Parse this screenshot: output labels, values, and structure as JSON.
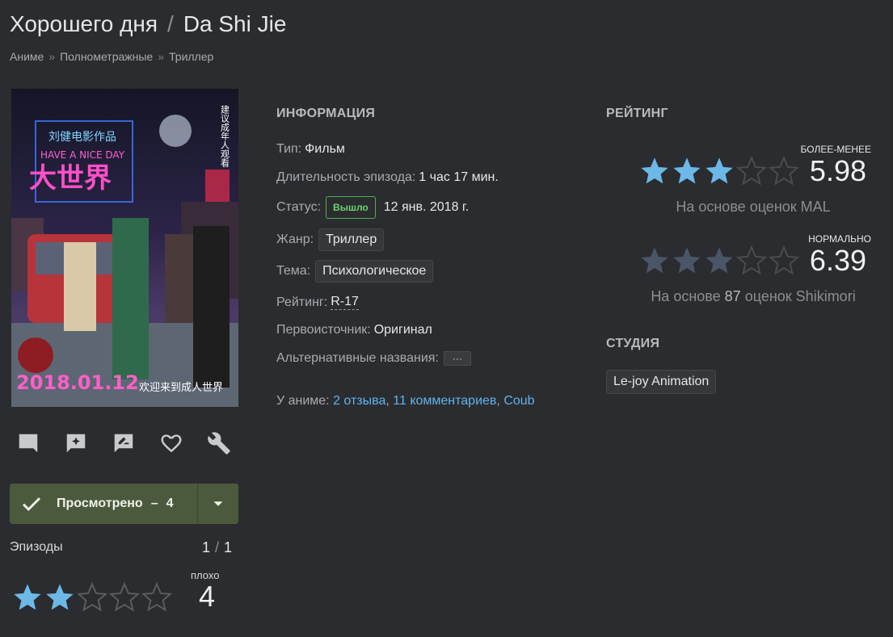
{
  "header": {
    "title_main": "Хорошего дня",
    "title_sep": "/",
    "title_orig": "Da Shi Jie",
    "breadcrumbs": [
      "Аниме",
      "Полнометражные",
      "Триллер"
    ],
    "crumb_sep": "»"
  },
  "poster": {
    "date_text": "2018.01.12",
    "title_text": "大世界",
    "side_text": "建议成年人观看",
    "tagline": "欢迎来到成人世界",
    "neon_subtitle": "刘健电影作品",
    "english_title": "HAVE A NICE DAY"
  },
  "actions": [
    {
      "icon": "comment-icon"
    },
    {
      "icon": "add-review-icon"
    },
    {
      "icon": "edit-review-icon"
    },
    {
      "icon": "heart-icon"
    },
    {
      "icon": "wrench-icon"
    }
  ],
  "watched_button": {
    "label": "Просмотрено",
    "dash": "–",
    "count": "4",
    "color": "#4b5a3c"
  },
  "episodes": {
    "label": "Эпизоды",
    "watched": "1",
    "slash": "/",
    "total": "1"
  },
  "user_rating": {
    "word": "плохо",
    "value": "4",
    "stars_filled": 2,
    "stars_total": 5
  },
  "info": {
    "heading": "ИНФОРМАЦИЯ",
    "type_label": "Тип:",
    "type_value": "Фильм",
    "duration_label": "Длительность эпизода:",
    "duration_value": "1 час 17 мин.",
    "status_label": "Статус:",
    "status_badge": "Вышло",
    "status_date": "12 янв. 2018 г.",
    "genre_label": "Жанр:",
    "genre_value": "Триллер",
    "theme_label": "Тема:",
    "theme_value": "Психологическое",
    "rating_label": "Рейтинг:",
    "rating_value": "R-17",
    "source_label": "Первоисточник:",
    "source_value": "Оригинал",
    "alt_label": "Альтернативные названия:",
    "alt_button": "···"
  },
  "reviews": {
    "prefix": "У аниме:",
    "reviews_link": "2 отзыва",
    "comments_link": "11 комментариев",
    "coub_link": "Coub",
    "comma": ","
  },
  "rating": {
    "heading": "РЕЙТИНГ",
    "mal": {
      "word": "БОЛЕЕ-МЕНЕЕ",
      "value": "5.98",
      "stars_filled": 3,
      "color": "#6cb8e6",
      "basis": "На основе оценок MAL"
    },
    "shikimori": {
      "word": "НОРМАЛЬНО",
      "value": "6.39",
      "stars_filled": 3,
      "color": "#4a5568",
      "basis_prefix": "На основе",
      "basis_count": "87",
      "basis_suffix": "оценок Shikimori"
    }
  },
  "studio": {
    "heading": "СТУДИЯ",
    "name": "Le-joy Animation"
  }
}
